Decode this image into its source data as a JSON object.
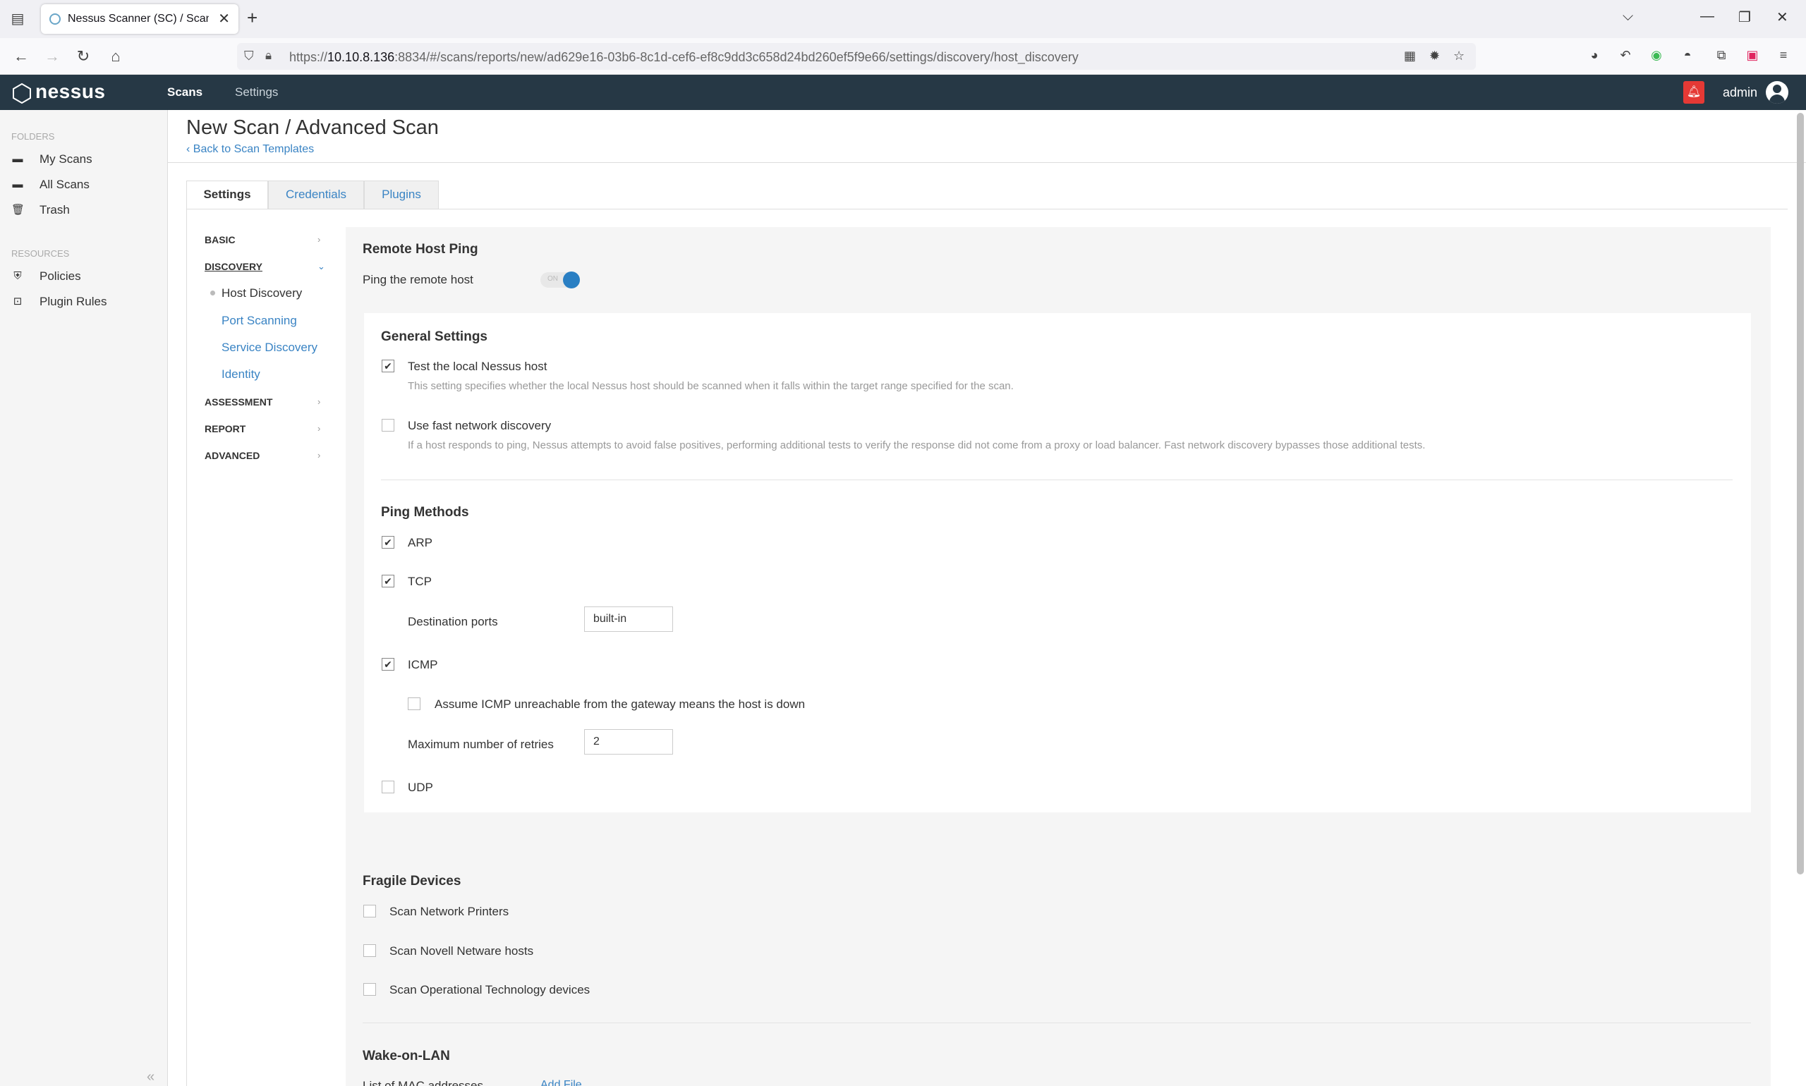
{
  "browser": {
    "tab_title": "Nessus Scanner (SC) / Scans",
    "url_prefix": "https://",
    "url_host": "10.10.8.136",
    "url_rest": ":8834/#/scans/reports/new/ad629e16-03b6-8c1d-cef6-ef8c9dd3c658d24bd260ef5f9e66/settings/discovery/host_discovery"
  },
  "app": {
    "logo": "nessus",
    "nav": {
      "scans": "Scans",
      "settings": "Settings"
    },
    "user": "admin"
  },
  "sidebar": {
    "folders_label": "FOLDERS",
    "folders": [
      {
        "label": "My Scans",
        "icon": "folder-icon"
      },
      {
        "label": "All Scans",
        "icon": "folder-icon"
      },
      {
        "label": "Trash",
        "icon": "trash-icon"
      }
    ],
    "resources_label": "RESOURCES",
    "resources": [
      {
        "label": "Policies",
        "icon": "shield-icon"
      },
      {
        "label": "Plugin Rules",
        "icon": "plugin-rules-icon"
      }
    ]
  },
  "page": {
    "title": "New Scan / Advanced Scan",
    "back_link": "Back to Scan Templates",
    "tabs": [
      "Settings",
      "Credentials",
      "Plugins"
    ]
  },
  "left_nav": {
    "basic": "BASIC",
    "discovery": "DISCOVERY",
    "discovery_items": [
      "Host Discovery",
      "Port Scanning",
      "Service Discovery",
      "Identity"
    ],
    "assessment": "ASSESSMENT",
    "report": "REPORT",
    "advanced": "ADVANCED"
  },
  "remote_host_ping": {
    "heading": "Remote Host Ping",
    "ping_label": "Ping the remote host",
    "toggle_text": "ON",
    "enabled": true
  },
  "general_settings": {
    "heading": "General Settings",
    "test_local": {
      "label": "Test the local Nessus host",
      "desc": "This setting specifies whether the local Nessus host should be scanned when it falls within the target range specified for the scan.",
      "checked": true
    },
    "fast_discovery": {
      "label": "Use fast network discovery",
      "desc": "If a host responds to ping, Nessus attempts to avoid false positives, performing additional tests to verify the response did not come from a proxy or load balancer. Fast network discovery bypasses those additional tests.",
      "checked": false
    }
  },
  "ping_methods": {
    "heading": "Ping Methods",
    "arp": {
      "label": "ARP",
      "checked": true
    },
    "tcp": {
      "label": "TCP",
      "checked": true
    },
    "dest_ports_label": "Destination ports",
    "dest_ports_value": "built-in",
    "icmp": {
      "label": "ICMP",
      "checked": true
    },
    "icmp_unreach": {
      "label": "Assume ICMP unreachable from the gateway means the host is down",
      "checked": false
    },
    "max_retries_label": "Maximum number of retries",
    "max_retries_value": "2",
    "udp": {
      "label": "UDP",
      "checked": false
    }
  },
  "fragile_devices": {
    "heading": "Fragile Devices",
    "items": [
      {
        "label": "Scan Network Printers",
        "checked": false
      },
      {
        "label": "Scan Novell Netware hosts",
        "checked": false
      },
      {
        "label": "Scan Operational Technology devices",
        "checked": false
      }
    ]
  },
  "wake_on_lan": {
    "heading": "Wake-on-LAN",
    "mac_label": "List of MAC addresses",
    "add_file": "Add File"
  },
  "checkmark": "✔"
}
